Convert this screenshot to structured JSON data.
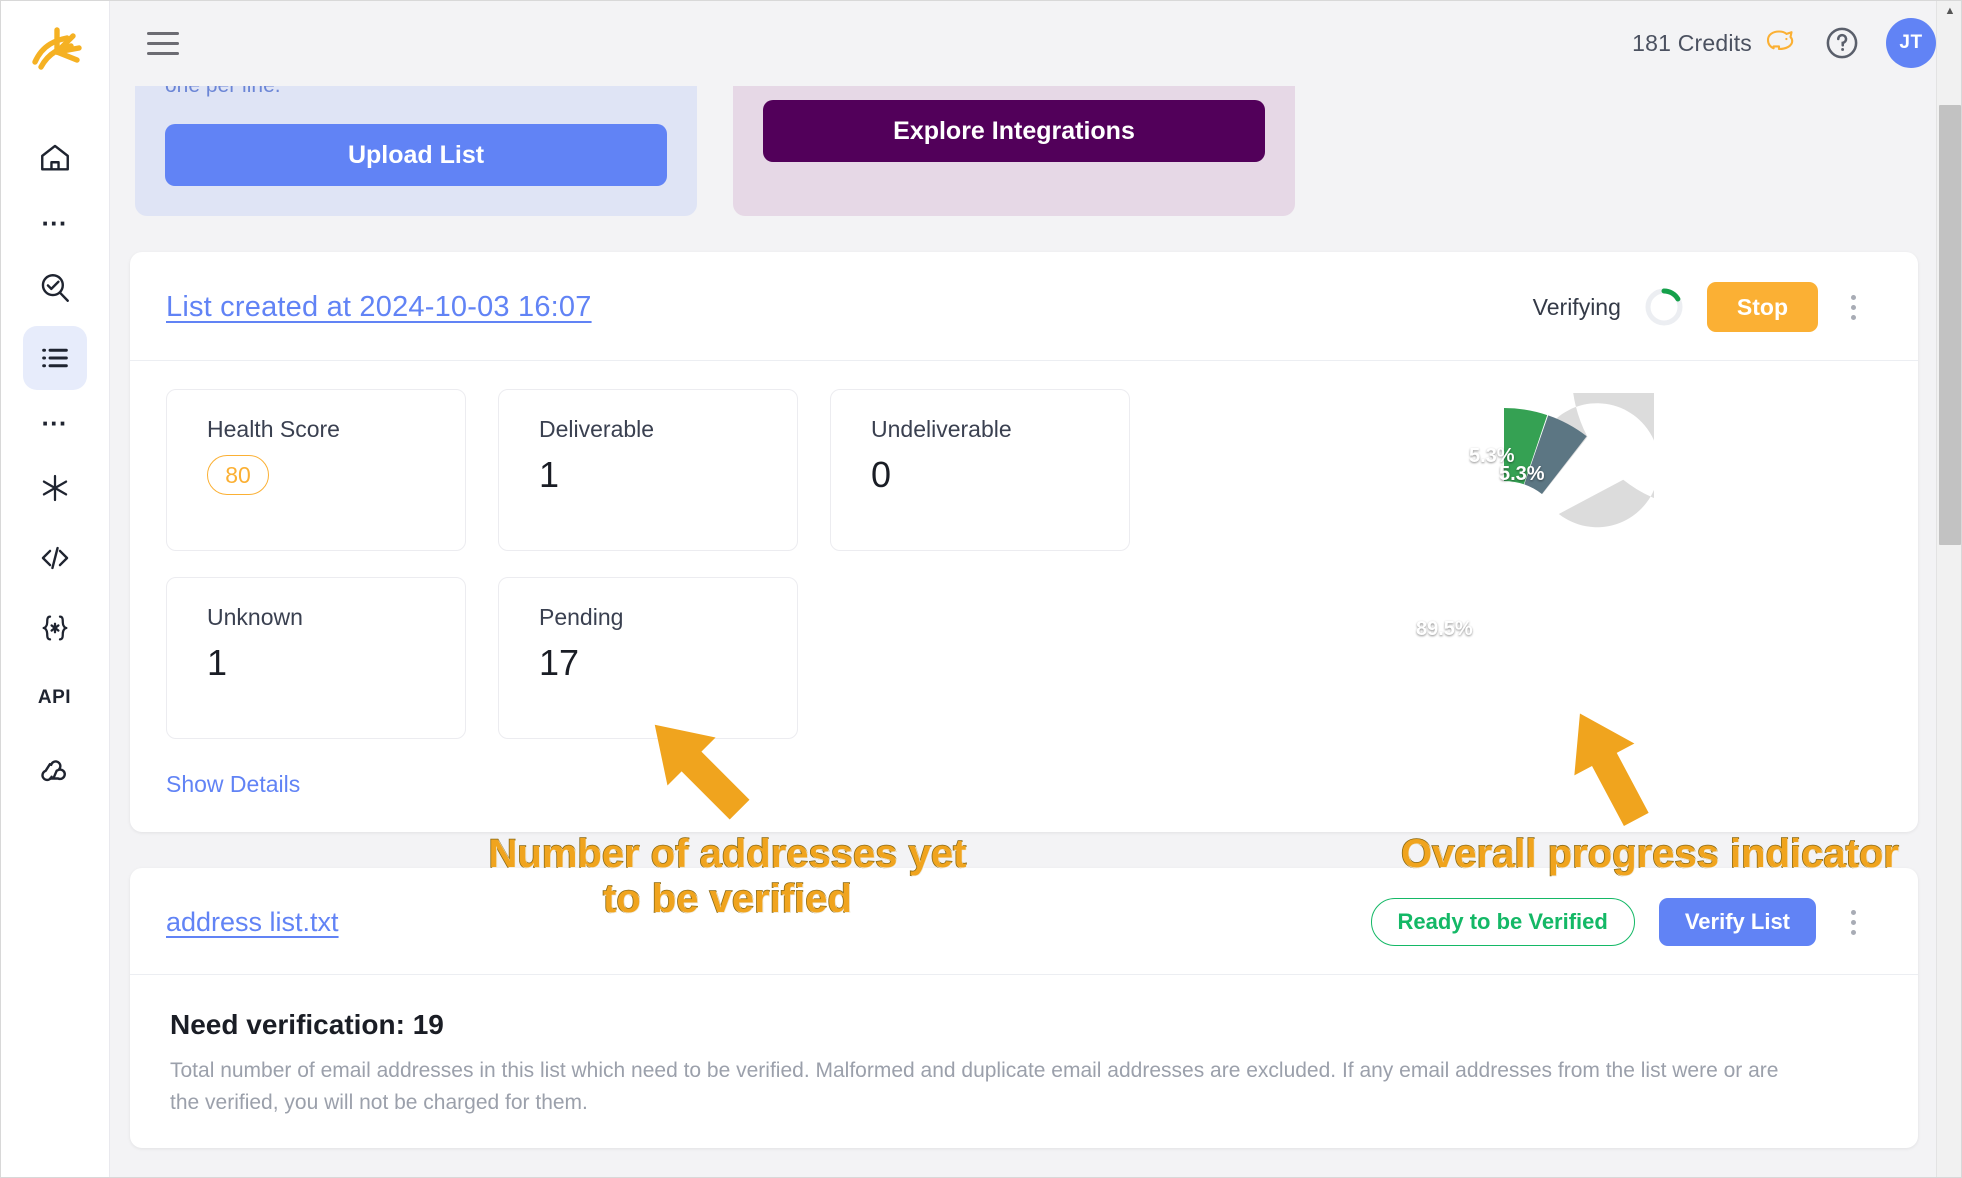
{
  "sidebar": {
    "logo_name": "brand-starburst-logo",
    "items": [
      {
        "name": "home-icon",
        "label": "Home"
      },
      {
        "name": "more-dots-icon",
        "label": "More"
      },
      {
        "name": "single-verify-icon",
        "label": "Single Verification"
      },
      {
        "name": "list-icon",
        "label": "Lists",
        "active": true
      },
      {
        "name": "more-dots-icon",
        "label": "More"
      },
      {
        "name": "asterisk-icon",
        "label": "Integrations"
      },
      {
        "name": "code-icon",
        "label": "Embed"
      },
      {
        "name": "braces-icon",
        "label": "Variables"
      },
      {
        "name": "api-icon",
        "label": "API"
      },
      {
        "name": "webhook-icon",
        "label": "Webhooks"
      }
    ],
    "api_label": "API"
  },
  "topbar": {
    "menu_icon": "hamburger-icon",
    "credits_label": "181 Credits",
    "piggy_icon": "piggy-bank-icon",
    "help_icon": "help-circle-icon",
    "avatar_initials": "JT"
  },
  "promos": [
    {
      "id": "upload-list",
      "text": "one per line.",
      "button_label": "Upload List",
      "bg": "#dfe4f5",
      "button_color": "#6183f5"
    },
    {
      "id": "explore-integrations",
      "text": "",
      "button_label": "Explore Integrations",
      "bg": "#e6d8e6",
      "button_color": "#52005a"
    }
  ],
  "list_card": {
    "title": "List created at 2024-10-03 16:07",
    "status": "Verifying",
    "spinner_color": "#15a04a",
    "stop_label": "Stop",
    "stop_color": "#fbb034",
    "menu_icon": "kebab-menu-icon",
    "stats": [
      {
        "label": "Health Score",
        "value": "80",
        "badge": true,
        "badge_color": "#fbb034"
      },
      {
        "label": "Deliverable",
        "value": "1",
        "badge": false
      },
      {
        "label": "Undeliverable",
        "value": "0",
        "badge": false
      },
      {
        "label": "Unknown",
        "value": "1",
        "badge": false
      },
      {
        "label": "Pending",
        "value": "17",
        "badge": false
      }
    ],
    "show_details_label": "Show Details"
  },
  "chart_data": {
    "type": "pie",
    "title": "",
    "categories": [
      "Deliverable",
      "Unknown",
      "Pending"
    ],
    "values": [
      5.3,
      5.3,
      89.5
    ],
    "labels": [
      "5.3%",
      "5.3%",
      "89.5%"
    ],
    "colors": [
      "#35a153",
      "#5c7683",
      "#dcdcdc"
    ],
    "donut": true,
    "inner_radius_ratio": 0.46,
    "start_angle_deg": 0,
    "legend": "none",
    "unit": "%"
  },
  "file_card": {
    "filename": "address list.txt",
    "status_pill": "Ready to be Verified",
    "status_color": "#14b866",
    "verify_label": "Verify List",
    "verify_color": "#6183f5",
    "menu_icon": "kebab-menu-icon",
    "need_title": "Need verification: 19",
    "need_desc": "Total number of email addresses in this list which need to be verified. Malformed and duplicate email addresses are excluded. If any email addresses from the list were or are the verified, you will not be charged for them."
  },
  "annotations": [
    {
      "id": "pending-callout",
      "text": "Number of addresses yet\nto be verified",
      "color": "#f0a41e"
    },
    {
      "id": "progress-callout",
      "text": "Overall progress indicator",
      "color": "#f0a41e"
    }
  ],
  "scrollbar": {
    "up_arrow": "▲"
  }
}
